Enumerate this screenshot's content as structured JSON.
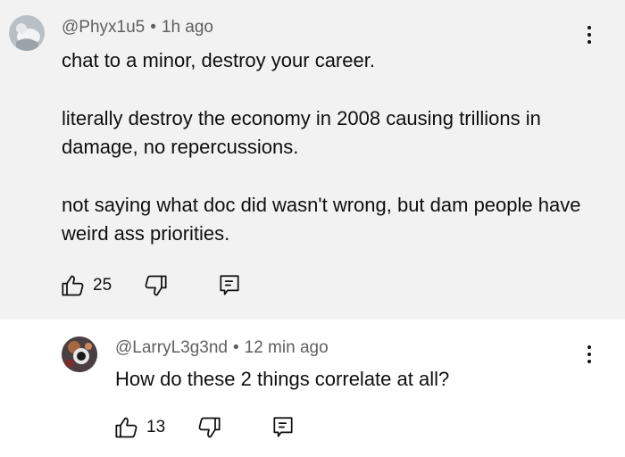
{
  "comments": [
    {
      "username": "@Phyx1u5",
      "separator": "•",
      "time": "1h ago",
      "paragraphs": [
        "chat to a minor, destroy your career.",
        "literally destroy the economy in 2008 causing trillions in damage, no repercussions.",
        "not saying what doc did wasn't wrong, but dam people have weird ass priorities."
      ],
      "likes": "25",
      "icons": [
        "avatar",
        "more-options-icon",
        "thumbs-up-icon",
        "thumbs-down-icon",
        "reply-comment-icon"
      ]
    },
    {
      "username": "@LarryL3g3nd",
      "separator": "•",
      "time": "12 min ago",
      "paragraphs": [
        "How do these 2 things correlate at all?"
      ],
      "likes": "13",
      "icons": [
        "avatar",
        "more-options-icon",
        "thumbs-up-icon",
        "thumbs-down-icon",
        "reply-comment-icon"
      ]
    }
  ],
  "colors": {
    "highlighted_background": "#f2f2f2",
    "background": "#ffffff",
    "primary_text": "#0f0f0f",
    "secondary_text": "#606060"
  }
}
